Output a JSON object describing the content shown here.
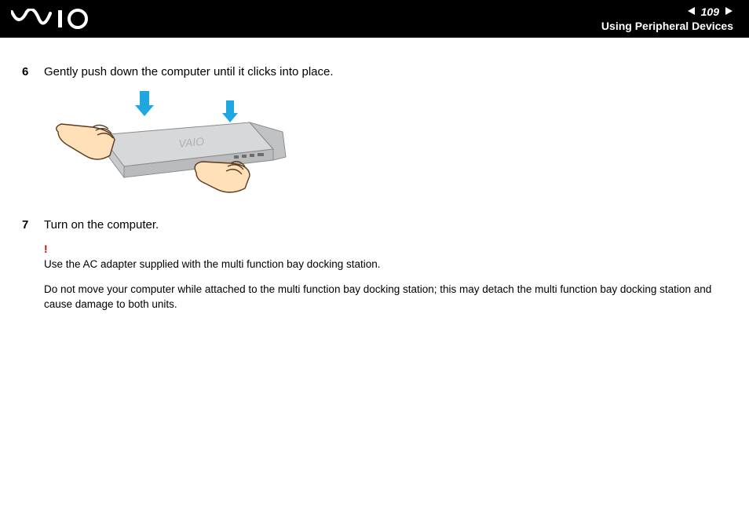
{
  "header": {
    "page_number": "109",
    "section_title": "Using Peripheral Devices"
  },
  "steps": [
    {
      "num": "6",
      "text": "Gently push down the computer until it clicks into place."
    },
    {
      "num": "7",
      "text": "Turn on the computer."
    }
  ],
  "notes": {
    "warning_mark": "!",
    "line1": "Use the AC adapter supplied with the multi function bay docking station.",
    "line2": "Do not move your computer while attached to the multi function bay docking station; this may detach the multi function bay docking station and cause damage to both units."
  }
}
